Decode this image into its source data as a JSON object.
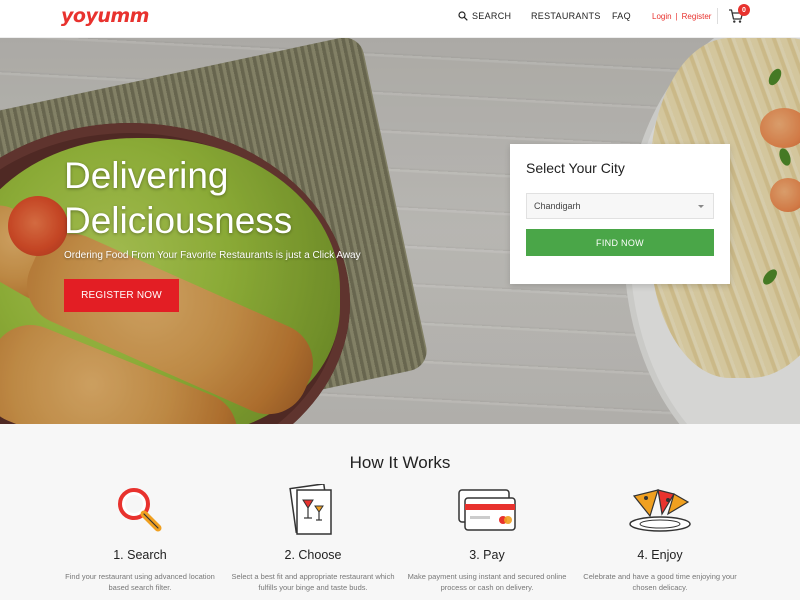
{
  "header": {
    "logo": "yoyumm",
    "nav": {
      "search": "SEARCH",
      "restaurants": "RESTAURANTS",
      "faq": "FAQ"
    },
    "auth": {
      "login": "Login",
      "separator": "|",
      "register": "Register"
    },
    "cart_count": "0"
  },
  "hero": {
    "title_line1": "Delivering",
    "title_line2": "Deliciousness",
    "subtitle": "Ordering Food From Your Favorite Restaurants is just a Click Away",
    "register_button": "REGISTER NOW",
    "city_box": {
      "title": "Select Your City",
      "selected_city": "Chandigarh",
      "find_button": "FIND NOW"
    }
  },
  "how_it_works": {
    "title": "How It Works",
    "steps": [
      {
        "title": "1. Search",
        "icon": "magnifier-icon",
        "desc": "Find your restaurant using advanced location based search filter."
      },
      {
        "title": "2. Choose",
        "icon": "menu-card-icon",
        "desc": "Select a best fit and appropriate restaurant which fulfills your binge and taste buds."
      },
      {
        "title": "3. Pay",
        "icon": "credit-card-icon",
        "desc": "Make payment using instant and secured online process or cash on delivery."
      },
      {
        "title": "4. Enjoy",
        "icon": "pizza-plate-icon",
        "desc": "Celebrate and have a good time enjoying your chosen delicacy."
      }
    ]
  },
  "colors": {
    "brand_red": "#e31e24",
    "brand_orange": "#f28b1e",
    "find_green": "#4aa648",
    "section_bg": "#f7f7f7"
  }
}
